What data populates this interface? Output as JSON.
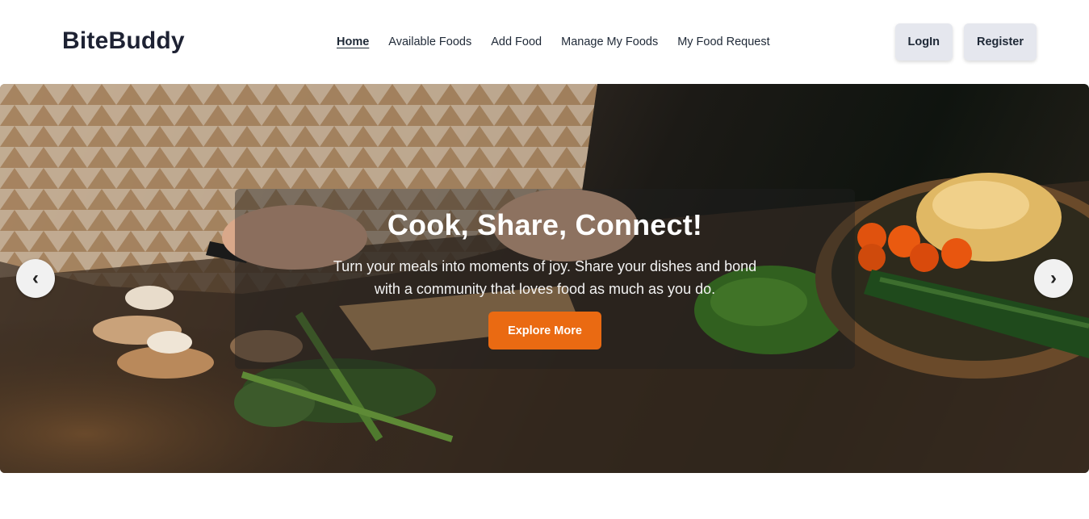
{
  "brand": {
    "name": "BiteBuddy"
  },
  "nav": {
    "items": [
      {
        "label": "Home",
        "active": true
      },
      {
        "label": "Available Foods",
        "active": false
      },
      {
        "label": "Add Food",
        "active": false
      },
      {
        "label": "Manage My Foods",
        "active": false
      },
      {
        "label": "My Food Request",
        "active": false
      }
    ]
  },
  "auth": {
    "login_label": "LogIn",
    "register_label": "Register"
  },
  "hero": {
    "title": "Cook, Share, Connect!",
    "subtitle": "Turn your meals into moments of joy. Share your dishes and bond with a community that loves food as much as you do.",
    "cta_label": "Explore More",
    "prev_icon": "‹",
    "next_icon": "›"
  },
  "colors": {
    "accent": "#ea6a12",
    "button_bg": "#e5e7ee",
    "logo": "#1e2233"
  }
}
